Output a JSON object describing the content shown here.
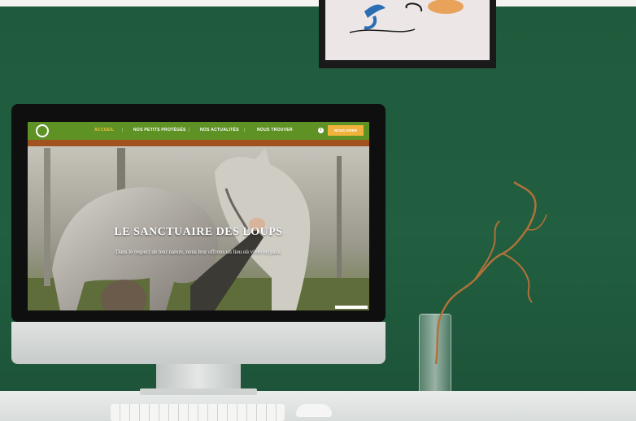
{
  "website": {
    "nav": {
      "items": [
        "ACCUEIL",
        "NOS PETITS PROTÉGÉS",
        "NOS ACTUALITÉS",
        "NOUS TROUVER"
      ],
      "separator": "|",
      "info_icon": "info-icon",
      "cta_label": "NOUS AIDER"
    },
    "hero": {
      "title": "LE SANCTUAIRE DES LOUPS",
      "subtitle": "Dans le respect de leur nature, nous leur offrons un lieu où vivre en paix."
    }
  },
  "colors": {
    "wall": "#215f40",
    "nav_green": "#5f9225",
    "accent_yellow": "#f0b23a"
  }
}
